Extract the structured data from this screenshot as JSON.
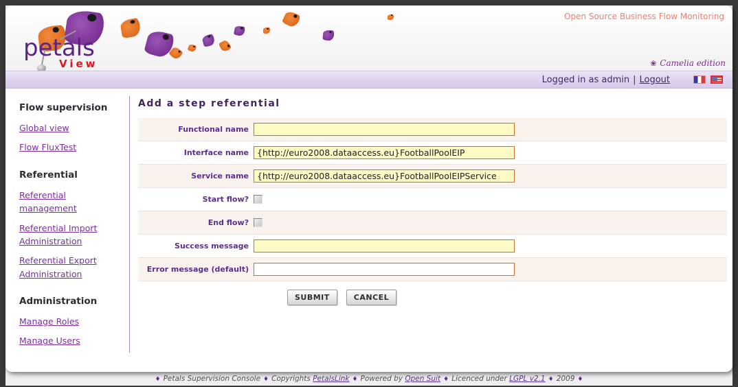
{
  "colors": {
    "brand_purple": "#6d2387",
    "brand_orange": "#d95f10",
    "logo_red": "#e01622",
    "tagline_salmon": "#ef8073",
    "link_purple": "#7b2f9e",
    "label_purple": "#5c2d91",
    "input_yellow": "#fdfac5",
    "input_border_orange": "#cd6d28",
    "userbar_lavender": "#d6c9e9"
  },
  "header": {
    "logo_text": "petals",
    "logo_subtext": "View",
    "tagline": "Open Source Business Flow Monitoring",
    "edition_icon": "❀",
    "edition": "Camelia edition"
  },
  "userbar": {
    "logged_in_text": "Logged in as admin",
    "separator": "|",
    "logout_label": "Logout",
    "flags": [
      "french-flag",
      "us-flag"
    ]
  },
  "sidebar": {
    "sections": [
      {
        "title": "Flow supervision",
        "links": [
          "Global view",
          "Flow FluxTest"
        ]
      },
      {
        "title": "Referential",
        "links": [
          "Referential management",
          "Referential Import Administration",
          "Referential Export Administration"
        ]
      },
      {
        "title": "Administration",
        "links": [
          "Manage Roles",
          "Manage Users"
        ]
      }
    ]
  },
  "main": {
    "title": "Add a step referential",
    "fields": [
      {
        "label": "Functional name",
        "type": "text",
        "value": ""
      },
      {
        "label": "Interface name",
        "type": "text",
        "value": "{http://euro2008.dataaccess.eu}FootballPoolEIP"
      },
      {
        "label": "Service name",
        "type": "text",
        "value": "{http://euro2008.dataaccess.eu}FootballPoolEIPService"
      },
      {
        "label": "Start flow?",
        "type": "checkbox",
        "checked": false
      },
      {
        "label": "End flow?",
        "type": "checkbox",
        "checked": false
      },
      {
        "label": "Success message",
        "type": "text",
        "value": ""
      },
      {
        "label": "Error message (default)",
        "type": "text",
        "value": ""
      }
    ],
    "submit_label": "SUBMIT",
    "cancel_label": "CANCEL"
  },
  "footer": {
    "diamond": "♦",
    "text1": "Petals Supervision Console",
    "text2": "Copyrights",
    "link1": "PetalsLink",
    "text3": "Powered by",
    "link2": "Open Suit",
    "text4": "Licenced under",
    "link3": "LGPL v2.1",
    "text5": "2009"
  }
}
